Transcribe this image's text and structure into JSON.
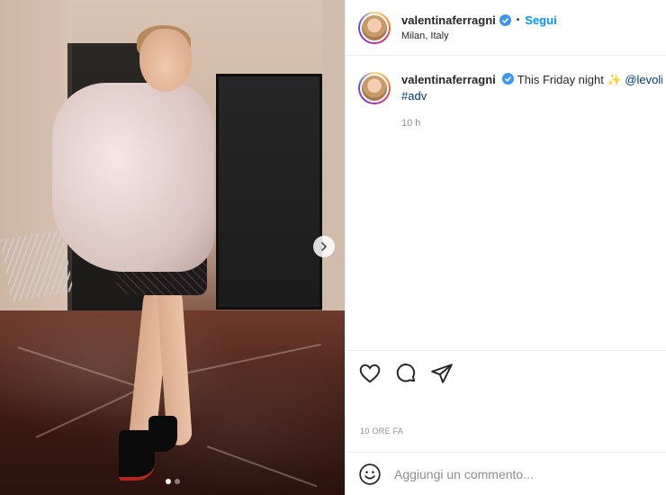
{
  "post": {
    "username": "valentinaferragni",
    "follow_label": "Segui",
    "location": "Milan, Italy",
    "caption_text": "This Friday night",
    "caption_emoji": "✨",
    "caption_mention": "@levolie",
    "caption_hashtag": "#adv",
    "caption_time": "10 h",
    "posted_ago": "10 ORE FA",
    "comment_placeholder": "Aggiungi un commento...",
    "carousel_slides": 2,
    "carousel_active": 1
  },
  "icons": {
    "verified": "verified-badge-icon",
    "like": "heart-icon",
    "comment": "comment-bubble-icon",
    "share": "paper-plane-icon",
    "emoji": "smiley-icon",
    "next": "chevron-right-icon"
  },
  "colors": {
    "link_blue": "#0095f6",
    "mention_blue": "#00376b",
    "text": "#262626",
    "muted": "#8e8e8e"
  }
}
